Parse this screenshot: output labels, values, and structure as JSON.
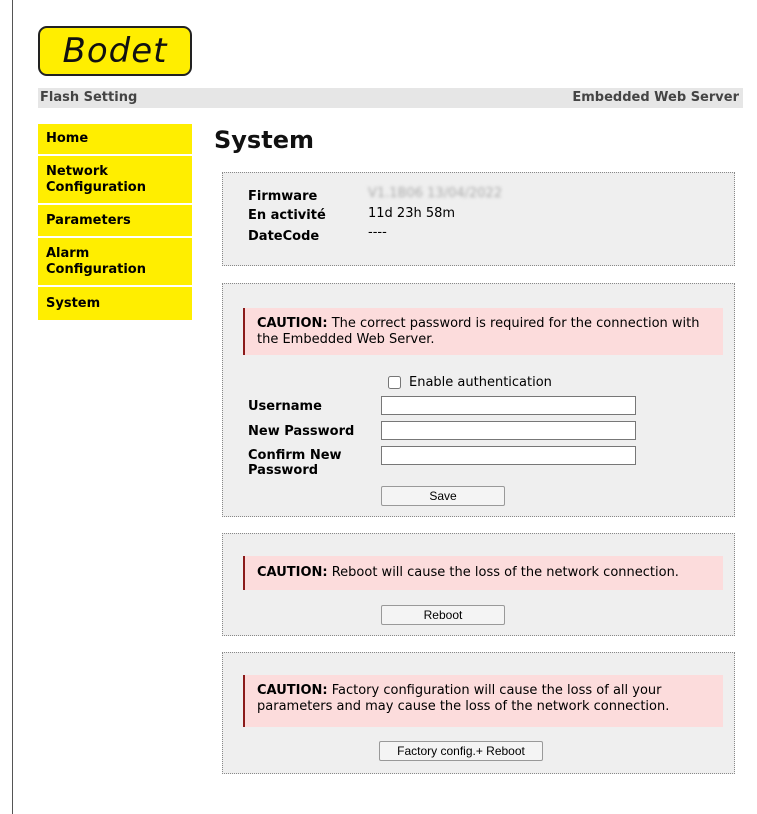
{
  "logo": {
    "text": "Bodet"
  },
  "topbar": {
    "left": "Flash Setting",
    "right": "Embedded Web Server"
  },
  "sidebar": {
    "items": [
      {
        "label": "Home"
      },
      {
        "label": "Network\nConfiguration"
      },
      {
        "label": "Parameters"
      },
      {
        "label": "Alarm\nConfiguration"
      },
      {
        "label": "System"
      }
    ]
  },
  "page": {
    "title": "System"
  },
  "info": {
    "firmware_label": "Firmware",
    "firmware_value": "V1.1B06 13/04/2022",
    "uptime_label": "En activité",
    "uptime_value": "11d 23h 58m",
    "datecode_label": "DateCode",
    "datecode_value": "----"
  },
  "auth": {
    "caution_strong": "CAUTION:",
    "caution_text": " The correct password is required for the connection with the Embedded Web Server.",
    "enable_label": "Enable authentication",
    "enable_checked": false,
    "username_label": "Username",
    "username_value": "",
    "new_password_label": "New Password",
    "new_password_value": "",
    "confirm_password_label": "Confirm New Password",
    "confirm_password_value": "",
    "save_label": "Save"
  },
  "reboot": {
    "caution_strong": "CAUTION:",
    "caution_text": " Reboot will cause the loss of the network connection.",
    "button_label": "Reboot"
  },
  "factory": {
    "caution_strong": "CAUTION:",
    "caution_text": " Factory configuration will cause the loss of all your parameters and may cause the loss of the network connection.",
    "button_label": "Factory config.+ Reboot"
  },
  "colors": {
    "brand_yellow": "#ffee00",
    "caution_bg": "#fcdcdc",
    "caution_border": "#8b1a1a",
    "panel_bg": "#efefef"
  }
}
